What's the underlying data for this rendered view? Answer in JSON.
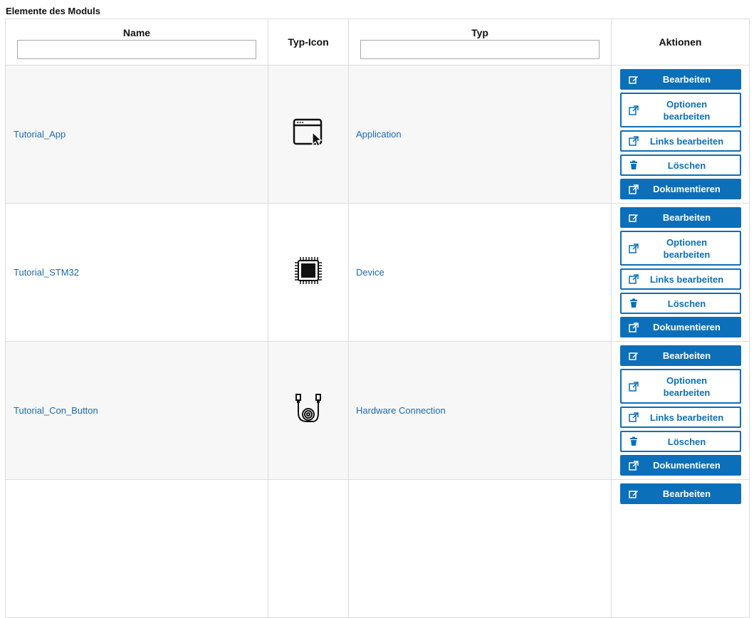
{
  "section_title": "Elemente des Moduls",
  "columns": {
    "name": "Name",
    "icon": "Typ-Icon",
    "typ": "Typ",
    "actions": "Aktionen"
  },
  "filters": {
    "name_value": "",
    "typ_value": ""
  },
  "actions": {
    "edit": "Bearbeiten",
    "edit_options": "Optionen bearbeiten",
    "edit_links": "Links bearbeiten",
    "delete": "Löschen",
    "document": "Dokumentieren"
  },
  "rows": [
    {
      "name": "Tutorial_App",
      "typ": "Application",
      "icon": "application-window-icon"
    },
    {
      "name": "Tutorial_STM32",
      "typ": "Device",
      "icon": "microchip-icon"
    },
    {
      "name": "Tutorial_Con_Button",
      "typ": "Hardware Connection",
      "icon": "cable-connector-icon"
    }
  ],
  "colors": {
    "primary": "#0c6fba",
    "link": "#1a69b3",
    "row_alt": "#f7f7f7",
    "border": "#dcdcdc"
  }
}
